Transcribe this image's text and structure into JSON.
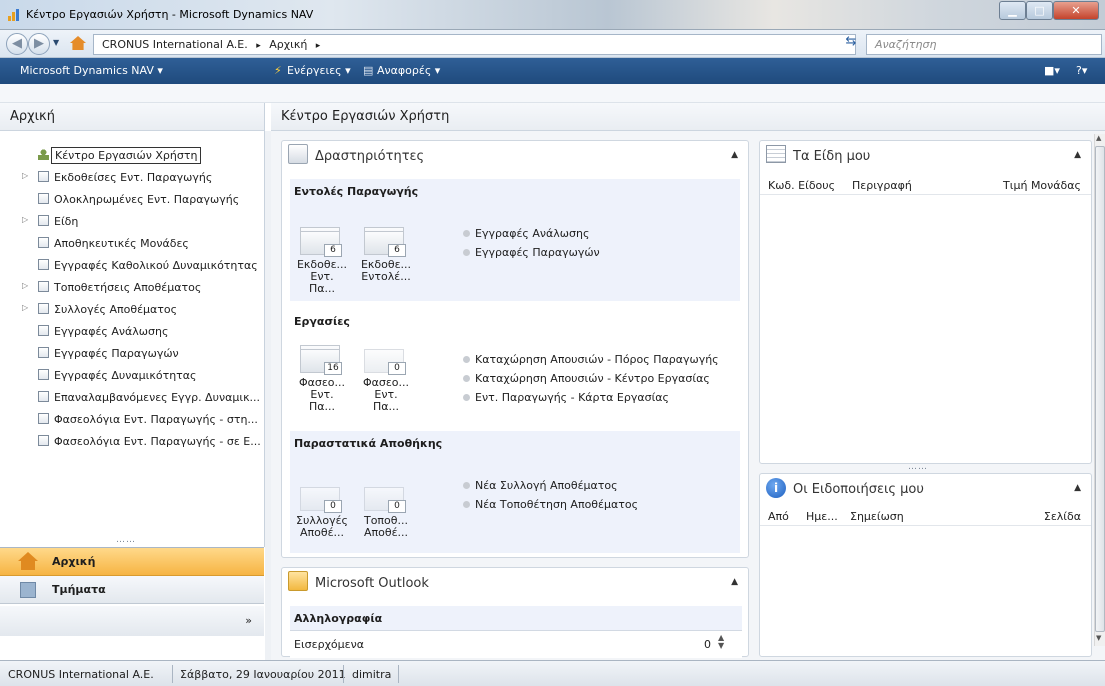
{
  "window": {
    "title": "Κέντρο Εργασιών Χρήστη - Microsoft Dynamics NAV"
  },
  "address": {
    "company": "CRONUS International A.E.",
    "sep1": "▸",
    "page": "Αρχική",
    "sep2": "▸",
    "search_placeholder": "Αναζήτηση"
  },
  "command_bar": {
    "app_menu": "Microsoft Dynamics NAV",
    "actions": "Ενέργειες",
    "reports": "Αναφορές"
  },
  "nav_pane": {
    "title": "Αρχική",
    "items": [
      {
        "label": "Κέντρο Εργασιών Χρήστη",
        "expandable": false,
        "selected": true
      },
      {
        "label": "Εκδοθείσες Εντ. Παραγωγής",
        "expandable": true
      },
      {
        "label": "Ολοκληρωμένες Εντ. Παραγωγής",
        "expandable": false
      },
      {
        "label": "Είδη",
        "expandable": true
      },
      {
        "label": "Αποθηκευτικές Μονάδες",
        "expandable": false
      },
      {
        "label": "Εγγραφές Καθολικού Δυναμικότητας",
        "expandable": false
      },
      {
        "label": "Τοποθετήσεις Αποθέματος",
        "expandable": true
      },
      {
        "label": "Συλλογές Αποθέματος",
        "expandable": true
      },
      {
        "label": "Εγγραφές Ανάλωσης",
        "expandable": false
      },
      {
        "label": "Εγγραφές Παραγωγών",
        "expandable": false
      },
      {
        "label": "Εγγραφές Δυναμικότητας",
        "expandable": false
      },
      {
        "label": "Επαναλαμβανόμενες Εγγρ. Δυναμικ...",
        "expandable": false
      },
      {
        "label": "Φασεολόγια Εντ. Παραγωγής - στη...",
        "expandable": false
      },
      {
        "label": "Φασεολόγια Εντ. Παραγωγής - σε Ε...",
        "expandable": false
      }
    ],
    "buttons": [
      {
        "label": "Αρχική"
      },
      {
        "label": "Τμήματα"
      }
    ],
    "more": "»"
  },
  "main": {
    "title": "Κέντρο Εργασιών Χρήστη",
    "activities": {
      "title": "Δραστηριότητες",
      "groups": [
        {
          "title": "Εντολές Παραγωγής",
          "cues": [
            {
              "count": "6",
              "l1": "Εκδοθε...",
              "l2": "Εντ. Πα..."
            },
            {
              "count": "6",
              "l1": "Εκδοθε...",
              "l2": "Εντολέ..."
            }
          ],
          "links": [
            "Εγγραφές Ανάλωσης",
            "Εγγραφές Παραγωγών"
          ]
        },
        {
          "title": "Εργασίες",
          "cues": [
            {
              "count": "16",
              "l1": "Φασεο...",
              "l2": "Εντ. Πα..."
            },
            {
              "count": "0",
              "l1": "Φασεο...",
              "l2": "Εντ. Πα..."
            }
          ],
          "links": [
            "Καταχώρηση Απουσιών - Πόρος Παραγωγής",
            "Καταχώρηση Απουσιών - Κέντρο Εργασίας",
            "Εντ. Παραγωγής - Κάρτα Εργασίας"
          ]
        },
        {
          "title": "Παραστατικά Αποθήκης",
          "cues": [
            {
              "count": "0",
              "l1": "Συλλογές",
              "l2": "Αποθέ..."
            },
            {
              "count": "0",
              "l1": "Τοποθ...",
              "l2": "Αποθέ..."
            }
          ],
          "links": [
            "Νέα Συλλογή Αποθέματος",
            "Νέα Τοποθέτηση Αποθέματος"
          ]
        }
      ]
    },
    "outlook": {
      "title": "Microsoft Outlook",
      "group": "Αλληλογραφία",
      "inbox_label": "Εισερχόμενα",
      "inbox_count": "0"
    },
    "my_items": {
      "title": "Τα Είδη μου",
      "cols": [
        "Κωδ. Είδους",
        "Περιγραφή",
        "Τιμή Μονάδας"
      ]
    },
    "my_notifications": {
      "title": "Οι Ειδοποιήσεις μου",
      "cols": [
        "Από",
        "Ημε...",
        "Σημείωση",
        "Σελίδα"
      ]
    }
  },
  "status": {
    "company": "CRONUS International A.E.",
    "date": "Σάββατο, 29 Ιανουαρίου 2011",
    "user": "dimitra"
  }
}
